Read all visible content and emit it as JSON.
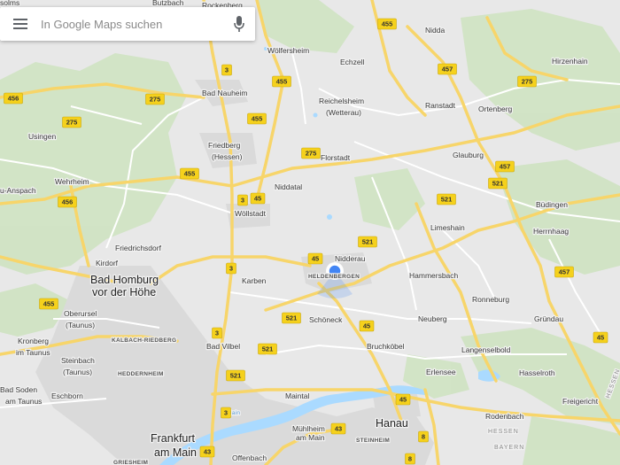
{
  "search": {
    "placeholder": "In Google Maps suchen"
  },
  "colors": {
    "land": "#e8e8e8",
    "urban": "#dcdcdc",
    "forest": "#cfe3c2",
    "water": "#aadaff",
    "highway": "#f7d56a",
    "road": "#ffffff",
    "shield": "#f5d11c",
    "location": "#4285f4"
  },
  "icons": {
    "menu": "hamburger-menu",
    "mic": "microphone",
    "location": "current-location-dot"
  },
  "places": [
    {
      "id": "butzbach",
      "name": "Butzbach"
    },
    {
      "id": "rockenberg",
      "name": "Rockenberg"
    },
    {
      "id": "solms",
      "name": "solms"
    },
    {
      "id": "nidda",
      "name": "Nidda"
    },
    {
      "id": "woelfersheim",
      "name": "Wölfersheim"
    },
    {
      "id": "echzell",
      "name": "Echzell"
    },
    {
      "id": "hirzenhain",
      "name": "Hirzenhain"
    },
    {
      "id": "bad-nauheim",
      "name": "Bad Nauheim"
    },
    {
      "id": "reichelsheim",
      "name": "Reichelsheim"
    },
    {
      "id": "wetterau",
      "name": "(Wetterau)"
    },
    {
      "id": "ranstadt",
      "name": "Ranstadt"
    },
    {
      "id": "ortenberg",
      "name": "Ortenberg"
    },
    {
      "id": "usingen",
      "name": "Usingen"
    },
    {
      "id": "friedberg",
      "name": "Friedberg"
    },
    {
      "id": "hessen",
      "name": "(Hessen)"
    },
    {
      "id": "florstadt",
      "name": "Florstadt"
    },
    {
      "id": "glauburg",
      "name": "Glauburg"
    },
    {
      "id": "anspach",
      "name": "u-Anspach"
    },
    {
      "id": "wehrheim",
      "name": "Wehrheim"
    },
    {
      "id": "niddatal",
      "name": "Niddatal"
    },
    {
      "id": "buedingen",
      "name": "Büdingen"
    },
    {
      "id": "woellstadt",
      "name": "Wöllstadt"
    },
    {
      "id": "limeshain",
      "name": "Limeshain"
    },
    {
      "id": "herrnhaag",
      "name": "Herrnhaag"
    },
    {
      "id": "friedrichsdorf",
      "name": "Friedrichsdorf"
    },
    {
      "id": "nidderau",
      "name": "Nidderau"
    },
    {
      "id": "kirdorf",
      "name": "Kirdorf"
    },
    {
      "id": "bad-homburg",
      "name": "Bad Homburg"
    },
    {
      "id": "vor-der-hoehe",
      "name": "vor der Höhe"
    },
    {
      "id": "karben",
      "name": "Karben"
    },
    {
      "id": "heldenbergen",
      "name": "HELDENBERGEN"
    },
    {
      "id": "hammersbach",
      "name": "Hammersbach"
    },
    {
      "id": "ronneburg",
      "name": "Ronneburg"
    },
    {
      "id": "oberursel",
      "name": "Oberursel"
    },
    {
      "id": "taunus1",
      "name": "(Taunus)"
    },
    {
      "id": "schoeneck",
      "name": "Schöneck"
    },
    {
      "id": "neuberg",
      "name": "Neuberg"
    },
    {
      "id": "gruendau",
      "name": "Gründau"
    },
    {
      "id": "kronberg",
      "name": "Kronberg"
    },
    {
      "id": "im-taunus",
      "name": "im Taunus"
    },
    {
      "id": "kalbach",
      "name": "KALBACH-RIEDBERG"
    },
    {
      "id": "bad-vilbel",
      "name": "Bad Vilbel"
    },
    {
      "id": "bruchkoebel",
      "name": "Bruchköbel"
    },
    {
      "id": "langenselbold",
      "name": "Langenselbold"
    },
    {
      "id": "steinbach",
      "name": "Steinbach"
    },
    {
      "id": "taunus2",
      "name": "(Taunus)"
    },
    {
      "id": "erlensee",
      "name": "Erlensee"
    },
    {
      "id": "hasselroth",
      "name": "Hasselroth"
    },
    {
      "id": "heddernheim",
      "name": "HEDDERNHEIM"
    },
    {
      "id": "bad-soden",
      "name": "Bad Soden"
    },
    {
      "id": "am-taunus",
      "name": "am Taunus"
    },
    {
      "id": "eschborn",
      "name": "Eschborn"
    },
    {
      "id": "maintal",
      "name": "Maintal"
    },
    {
      "id": "freigericht",
      "name": "Freigericht"
    },
    {
      "id": "rodenbach",
      "name": "Rodenbach"
    },
    {
      "id": "hanau",
      "name": "Hanau"
    },
    {
      "id": "muehlheim",
      "name": "Mühlheim"
    },
    {
      "id": "am-main2",
      "name": "am Main"
    },
    {
      "id": "steinheim",
      "name": "STEINHEIM"
    },
    {
      "id": "frankfurt",
      "name": "Frankfurt"
    },
    {
      "id": "am-main",
      "name": "am Main"
    },
    {
      "id": "offenbach",
      "name": "Offenbach"
    },
    {
      "id": "griesheim",
      "name": "GRIESHEIM"
    },
    {
      "id": "hessen-region",
      "name": "HESSEN"
    },
    {
      "id": "bayern-region",
      "name": "BAYERN"
    },
    {
      "id": "hessen-vertical",
      "name": "HESSEN"
    },
    {
      "id": "main-river",
      "name": "Main"
    }
  ],
  "road_shields": [
    {
      "id": "s455a",
      "label": "455"
    },
    {
      "id": "s457a",
      "label": "457"
    },
    {
      "id": "s275a",
      "label": "275"
    },
    {
      "id": "s3a",
      "label": "3"
    },
    {
      "id": "s455b",
      "label": "455"
    },
    {
      "id": "s456a",
      "label": "456"
    },
    {
      "id": "s275b",
      "label": "275"
    },
    {
      "id": "s455c",
      "label": "455"
    },
    {
      "id": "s275c",
      "label": "275"
    },
    {
      "id": "s275d",
      "label": "275"
    },
    {
      "id": "s457b",
      "label": "457"
    },
    {
      "id": "s455d",
      "label": "455"
    },
    {
      "id": "s521a",
      "label": "521"
    },
    {
      "id": "s3b",
      "label": "3"
    },
    {
      "id": "s45a",
      "label": "45"
    },
    {
      "id": "s456b",
      "label": "456"
    },
    {
      "id": "s521b",
      "label": "521"
    },
    {
      "id": "s521c",
      "label": "521"
    },
    {
      "id": "s45b",
      "label": "45"
    },
    {
      "id": "s3c",
      "label": "3"
    },
    {
      "id": "s457c",
      "label": "457"
    },
    {
      "id": "s455e",
      "label": "455"
    },
    {
      "id": "s521d",
      "label": "521"
    },
    {
      "id": "s45c",
      "label": "45"
    },
    {
      "id": "s3d",
      "label": "3"
    },
    {
      "id": "s521e",
      "label": "521"
    },
    {
      "id": "s521f",
      "label": "521"
    },
    {
      "id": "s45d",
      "label": "45"
    },
    {
      "id": "s43a",
      "label": "43"
    },
    {
      "id": "s8a",
      "label": "8"
    },
    {
      "id": "s43b",
      "label": "43"
    },
    {
      "id": "s8b",
      "label": "8"
    },
    {
      "id": "s3e",
      "label": "3"
    },
    {
      "id": "s45e",
      "label": "45"
    }
  ]
}
